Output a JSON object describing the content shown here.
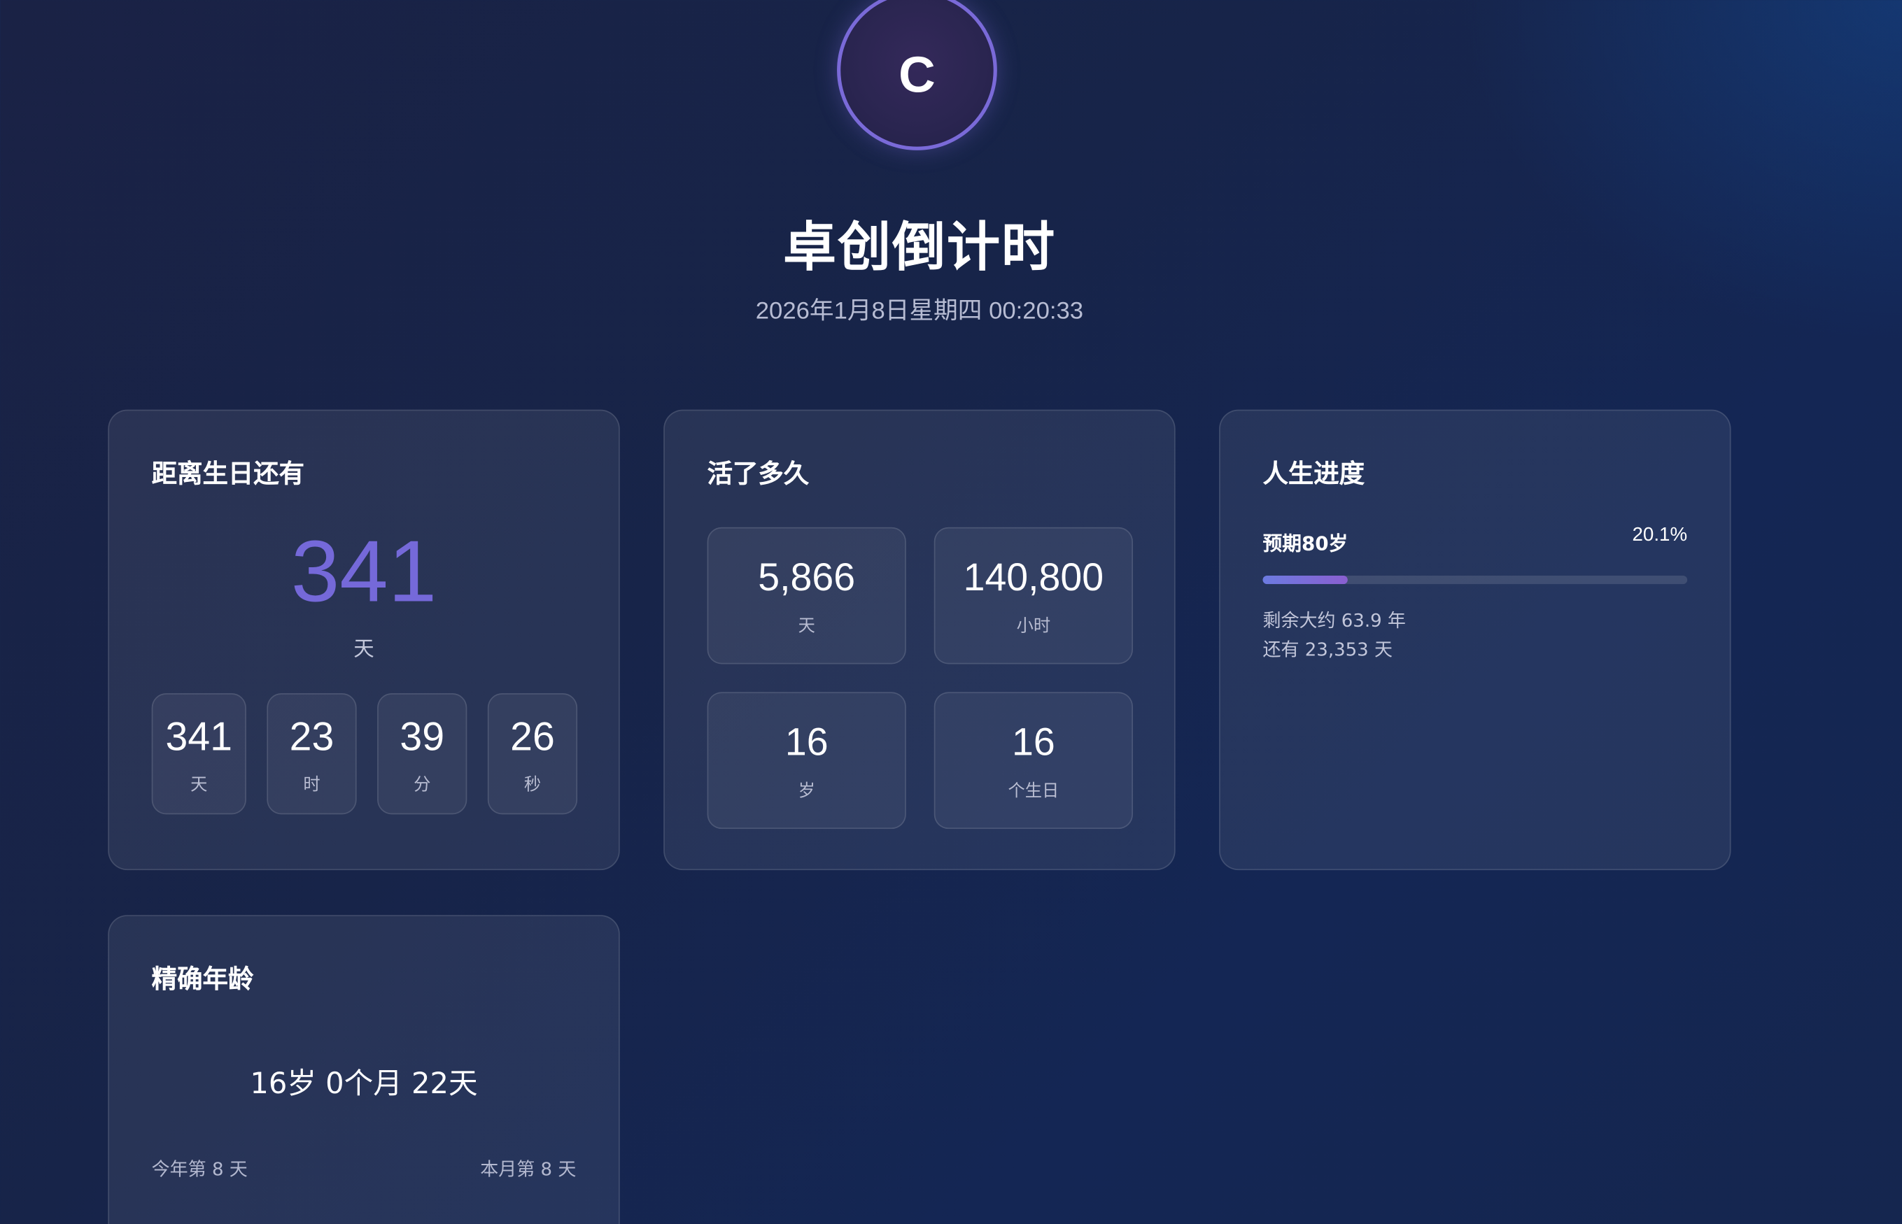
{
  "avatar": {
    "letter": "C"
  },
  "header": {
    "title": "卓创倒计时",
    "datetime": "2026年1月8日星期四 00:20:33"
  },
  "birthday": {
    "title": "距离生日还有",
    "big_value": "341",
    "big_unit": "天",
    "units": [
      {
        "value": "341",
        "label": "天"
      },
      {
        "value": "23",
        "label": "时"
      },
      {
        "value": "39",
        "label": "分"
      },
      {
        "value": "26",
        "label": "秒"
      }
    ]
  },
  "lived": {
    "title": "活了多久",
    "stats": [
      {
        "value": "5,866",
        "label": "天"
      },
      {
        "value": "140,800",
        "label": "小时"
      },
      {
        "value": "16",
        "label": "岁"
      },
      {
        "value": "16",
        "label": "个生日"
      }
    ]
  },
  "life_progress": {
    "title": "人生进度",
    "expectancy_label": "预期80岁",
    "percent_text": "20.1%",
    "percent": 20.1,
    "remaining_years": "剩余大约 63.9 年",
    "remaining_days": "还有 23,353 天"
  },
  "exact_age": {
    "title": "精确年龄",
    "age": "16岁 0个月 22天",
    "day_of_year": "今年第 8 天",
    "day_of_month": "本月第 8 天"
  },
  "colors": {
    "accent": "#7569d9",
    "progress_start": "#6c7be0",
    "progress_end": "#8a5fd0"
  }
}
